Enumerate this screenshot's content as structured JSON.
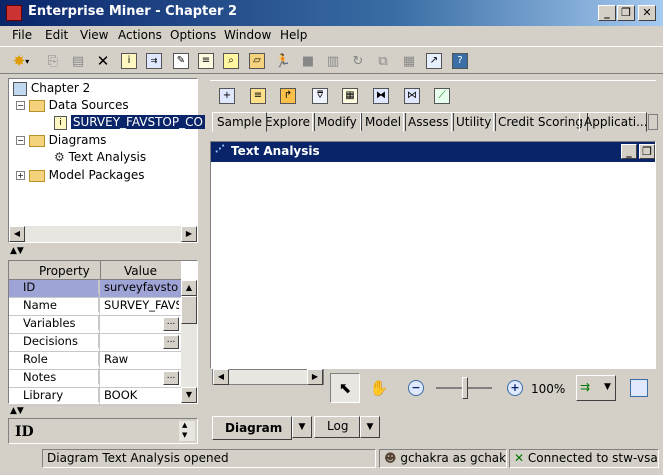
{
  "window": {
    "title": "Enterprise Miner - Chapter 2",
    "minimize": "_",
    "restore": "❐",
    "close": "✕"
  },
  "menu": [
    "File",
    "Edit",
    "View",
    "Actions",
    "Options",
    "Window",
    "Help"
  ],
  "toolbar_icons": [
    "new-icon",
    "copy-icon",
    "paste-icon",
    "delete-icon",
    "node-icon",
    "flow-icon",
    "document-icon",
    "notes-icon",
    "zoom-icon",
    "folder-open-icon",
    "run-icon",
    "stop-icon",
    "results-icon",
    "refresh-icon",
    "compare-icon",
    "report-icon",
    "export-icon",
    "help-book-icon"
  ],
  "tree": {
    "root": "Chapter 2",
    "data_sources": "Data Sources",
    "data_source_item": "SURVEY_FAVSTOP_CO",
    "diagrams": "Diagrams",
    "diagram_item": "Text Analysis",
    "model_packages": "Model Packages"
  },
  "properties": {
    "col_property": "Property",
    "col_value": "Value",
    "rows": [
      {
        "name": "ID",
        "value": "surveyfavstop"
      },
      {
        "name": "Name",
        "value": "SURVEY_FAVS"
      },
      {
        "name": "Variables",
        "value": ""
      },
      {
        "name": "Decisions",
        "value": ""
      },
      {
        "name": "Role",
        "value": "Raw"
      },
      {
        "name": "Notes",
        "value": ""
      },
      {
        "name": "Library",
        "value": "BOOK"
      }
    ],
    "ellipsis": "..."
  },
  "description": {
    "value": "ID"
  },
  "node_tabs": [
    "Sample",
    "Explore",
    "Modify",
    "Model",
    "Assess",
    "Utility",
    "Credit Scoring",
    "Applicati..."
  ],
  "diagram": {
    "title": "Text Analysis"
  },
  "diagram_controls": {
    "zoom": "100%"
  },
  "bottom_tabs": {
    "diagram": "Diagram",
    "log": "Log"
  },
  "status": {
    "message": "Diagram Text Analysis opened",
    "user": "gchakra as gchakra",
    "connection": "Connected to stw-vsas"
  },
  "colors": {
    "title_bar": "#0a246a",
    "chrome": "#d4d0c8",
    "selection": "#0a246a",
    "id_row": "#9ea4d6"
  }
}
